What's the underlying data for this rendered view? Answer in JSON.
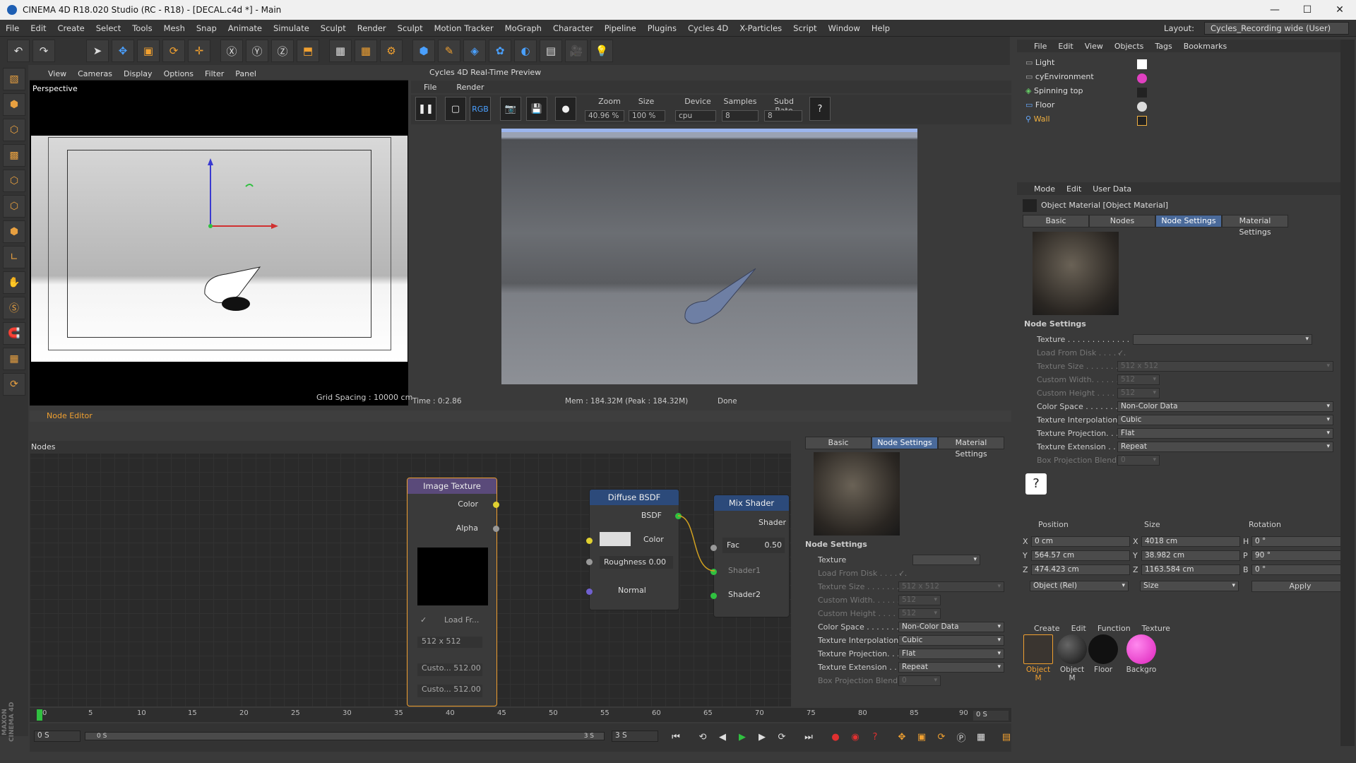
{
  "window": {
    "title": "CINEMA 4D R18.020 Studio (RC - R18) - [DECAL.c4d *] - Main",
    "minimize": "—",
    "maximize": "☐",
    "close": "✕"
  },
  "menu": [
    "File",
    "Edit",
    "Create",
    "Select",
    "Tools",
    "Mesh",
    "Snap",
    "Animate",
    "Simulate",
    "Sculpt",
    "Render",
    "Sculpt",
    "Motion Tracker",
    "MoGraph",
    "Character",
    "Pipeline",
    "Plugins",
    "Cycles 4D",
    "X-Particles",
    "Script",
    "Window",
    "Help"
  ],
  "layout": {
    "label": "Layout:",
    "value": "Cycles_Recording wide (User)"
  },
  "viewport": {
    "menu": [
      "View",
      "Cameras",
      "Display",
      "Options",
      "Filter",
      "Panel"
    ],
    "label": "Perspective",
    "grid": "Grid Spacing : 10000 cm"
  },
  "preview": {
    "title": "Cycles 4D Real-Time Preview",
    "menu": [
      "File",
      "Render"
    ],
    "rgb": "RGB",
    "zoom_label": "Zoom",
    "zoom": "40.96 %",
    "size_label": "Size",
    "size": "100 %",
    "device_label": "Device",
    "device": "cpu",
    "samples_label": "Samples",
    "samples": "8",
    "subd_label": "Subd Rate",
    "subd": "8",
    "status_time": "Time : 0:2.86",
    "status_mem": "Mem : 184.32M (Peak : 184.32M)",
    "status_done": "Done"
  },
  "node_editor": {
    "title": "Node Editor",
    "nodes_label": "Nodes",
    "image_texture": {
      "title": "Image Texture",
      "color": "Color",
      "alpha": "Alpha",
      "load": "Load Fr...",
      "size": "512 x 512",
      "cw_label": "Custo...",
      "cw": "512.00",
      "ch_label": "Custo...",
      "ch": "512.00"
    },
    "diffuse": {
      "title": "Diffuse BSDF",
      "bsdf": "BSDF",
      "color": "Color",
      "roughness": "Roughness 0.00",
      "normal": "Normal"
    },
    "mix": {
      "title": "Mix Shader",
      "shader": "Shader",
      "fac": "Fac",
      "fac_val": "0.50",
      "shader1": "Shader1",
      "shader2": "Shader2"
    }
  },
  "mid_props": {
    "tabs": [
      "Basic",
      "Node Settings",
      "Material Settings"
    ],
    "section": "Node Settings",
    "rows": [
      {
        "label": "Texture",
        "value": "",
        "dim": false
      },
      {
        "label": "Load From Disk . . . . . .",
        "value": "✓",
        "dim": true
      },
      {
        "label": "Texture Size . . . . . . .",
        "value": "512 x 512",
        "dim": true
      },
      {
        "label": "Custom Width. . . . . .",
        "value": "512",
        "dim": true
      },
      {
        "label": "Custom Height . . . . .",
        "value": "512",
        "dim": true
      },
      {
        "label": "Color Space . . . . . . . .",
        "value": "Non-Color Data",
        "dim": false
      },
      {
        "label": "Texture Interpolation",
        "value": "Cubic",
        "dim": false
      },
      {
        "label": "Texture Projection. . .",
        "value": "Flat",
        "dim": false
      },
      {
        "label": "Texture Extension . . .",
        "value": "Repeat",
        "dim": false
      },
      {
        "label": "Box Projection Blend",
        "value": "0",
        "dim": true
      }
    ]
  },
  "objects": {
    "menu": [
      "File",
      "Edit",
      "View",
      "Objects",
      "Tags",
      "Bookmarks"
    ],
    "items": [
      {
        "name": "Light",
        "color": "#dddddd"
      },
      {
        "name": "cyEnvironment",
        "color": "#dddddd"
      },
      {
        "name": "Spinning top",
        "color": "#dddddd"
      },
      {
        "name": "Floor",
        "color": "#dddddd"
      },
      {
        "name": "Wall",
        "color": "#f0b040"
      }
    ]
  },
  "attributes": {
    "menu": [
      "Mode",
      "Edit",
      "User Data"
    ],
    "title": "Object Material [Object Material]",
    "tabs": [
      "Basic",
      "Nodes",
      "Node Settings",
      "Material Settings"
    ],
    "section": "Node Settings",
    "rows": [
      {
        "label": "Texture . . . . . . . . . . . . .",
        "value": "",
        "dim": false
      },
      {
        "label": "Load From Disk . . . . . .",
        "value": "✓",
        "dim": true
      },
      {
        "label": "Texture Size . . . . . . .",
        "value": "512 x 512",
        "dim": true
      },
      {
        "label": "Custom Width. . . . . .",
        "value": "512",
        "dim": true
      },
      {
        "label": "Custom Height . . . . .",
        "value": "512",
        "dim": true
      },
      {
        "label": "Color Space . . . . . . . .",
        "value": "Non-Color Data",
        "dim": false
      },
      {
        "label": "Texture Interpolation",
        "value": "Cubic",
        "dim": false
      },
      {
        "label": "Texture Projection. . .",
        "value": "Flat",
        "dim": false
      },
      {
        "label": "Texture Extension . . .",
        "value": "Repeat",
        "dim": false
      },
      {
        "label": "Box Projection Blend",
        "value": "0",
        "dim": true
      }
    ]
  },
  "coords": {
    "headers": [
      "Position",
      "Size",
      "Rotation"
    ],
    "rows": [
      {
        "a": "X",
        "pos": "0 cm",
        "b": "X",
        "size": "4018 cm",
        "c": "H",
        "rot": "0 °"
      },
      {
        "a": "Y",
        "pos": "564.57 cm",
        "b": "Y",
        "size": "38.982 cm",
        "c": "P",
        "rot": "90 °"
      },
      {
        "a": "Z",
        "pos": "474.423 cm",
        "b": "Z",
        "size": "1163.584 cm",
        "c": "B",
        "rot": "0 °"
      }
    ],
    "mode": "Object (Rel)",
    "size_mode": "Size",
    "apply": "Apply"
  },
  "materials": {
    "menu": [
      "Create",
      "Edit",
      "Function",
      "Texture"
    ],
    "items": [
      {
        "name": "Object M",
        "color": "#3a3530"
      },
      {
        "name": "Object M",
        "color": "#222222"
      },
      {
        "name": "Floor",
        "color": "#111111"
      },
      {
        "name": "Backgro",
        "color": "#ee44cc"
      }
    ]
  },
  "timeline": {
    "ticks": [
      "0",
      "5",
      "10",
      "15",
      "20",
      "25",
      "30",
      "35",
      "40",
      "45",
      "50",
      "55",
      "60",
      "65",
      "70",
      "75",
      "80",
      "85",
      "90"
    ],
    "current": "0 S",
    "start": "0 S",
    "range_start": "0 S",
    "range_end": "3 S",
    "end": "3 S"
  },
  "colors": {
    "accent": "#f0a030",
    "tab_active": "#4a6a9a"
  }
}
